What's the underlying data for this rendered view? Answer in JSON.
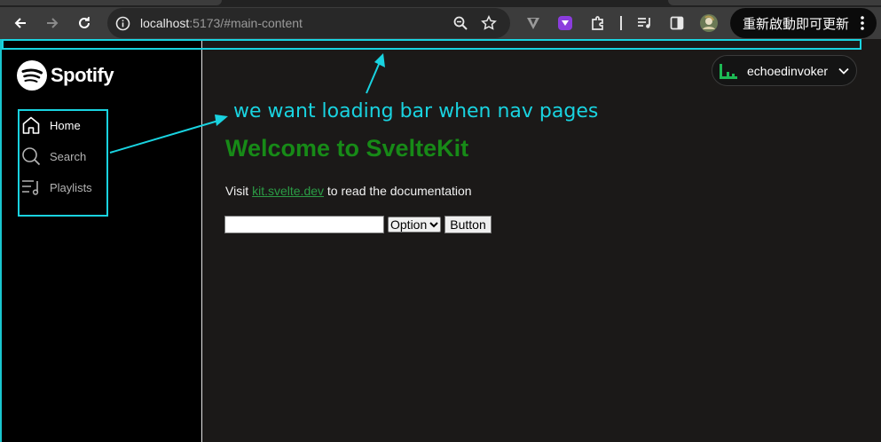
{
  "browser": {
    "url_host": "localhost",
    "url_path": ":5173/#main-content",
    "update_label": "重新啟動即可更新",
    "icons": [
      "back-icon",
      "forward-icon",
      "reload-icon",
      "site-info-icon",
      "zoom-icon",
      "bookmark-star-icon",
      "vpn-extension-icon",
      "purple-extension-icon",
      "extensions-puzzle-icon",
      "media-control-icon",
      "side-panel-icon",
      "profile-avatar-icon",
      "more-menu-icon"
    ]
  },
  "app": {
    "logo_text": "Spotify",
    "nav": [
      {
        "label": "Home",
        "icon": "home-icon",
        "active": true
      },
      {
        "label": "Search",
        "icon": "search-icon",
        "active": false
      },
      {
        "label": "Playlists",
        "icon": "playlist-icon",
        "active": false
      }
    ],
    "user": {
      "name": "echoedinvoker"
    },
    "main": {
      "heading": "Welcome to SvelteKit",
      "visit_prefix": "Visit",
      "visit_link": "kit.svelte.dev",
      "visit_suffix": "to read the documentation",
      "input_value": "",
      "select_value": "Option",
      "button_label": "Button"
    }
  },
  "annotation": {
    "text": "we want loading bar when nav pages",
    "color": "#19d3e0"
  },
  "colors": {
    "heading_green": "#178a17",
    "link_green": "#2b9c45",
    "spotify_green": "#1db954",
    "background": "#1b1918",
    "sidebar": "#000000"
  }
}
